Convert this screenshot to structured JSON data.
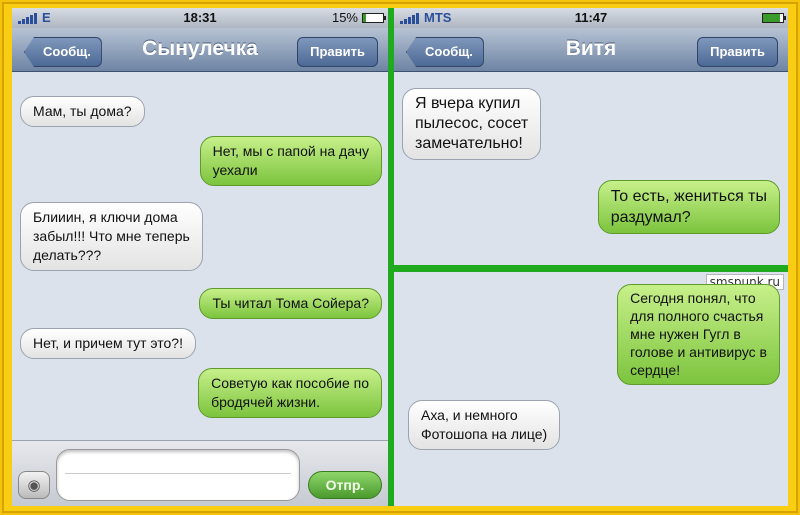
{
  "chat1": {
    "status": {
      "carrier": "E",
      "time": "18:31",
      "battery_text": "15%"
    },
    "nav": {
      "back_label": "Сообщ.",
      "title": "Сынулечка",
      "edit_label": "Править"
    },
    "messages": [
      {
        "dir": "in",
        "lines": [
          "Мам, ты дома?"
        ]
      },
      {
        "dir": "out",
        "lines": [
          "Нет, мы с папой на дачу",
          "уехали"
        ]
      },
      {
        "dir": "in",
        "lines": [
          "Блииин, я ключи дома",
          "забыл!!! Что мне теперь",
          "делать???"
        ]
      },
      {
        "dir": "out",
        "lines": [
          "Ты читал Тома Сойера?"
        ]
      },
      {
        "dir": "in",
        "lines": [
          "Нет, и причем тут это?!"
        ]
      },
      {
        "dir": "out",
        "lines": [
          "Советую как пособие по",
          "бродячей жизни."
        ]
      }
    ],
    "composer": {
      "send_label": "Отпр."
    }
  },
  "chat2": {
    "status": {
      "carrier": "MTS",
      "time": "11:47"
    },
    "nav": {
      "back_label": "Сообщ.",
      "title": "Витя",
      "edit_label": "Править"
    },
    "messages": [
      {
        "dir": "in",
        "lines": [
          "Я вчера купил",
          "пылесос, сосет",
          "замечательно!"
        ]
      },
      {
        "dir": "out",
        "lines": [
          "То есть, жениться ты",
          "раздумал?"
        ]
      }
    ]
  },
  "chat3": {
    "watermark": "smspunk.ru",
    "messages": [
      {
        "dir": "out",
        "lines": [
          "Сегодня понял, что",
          "для полного счастья",
          "мне нужен Гугл в",
          "голове и антивирус в",
          "сердце!"
        ]
      },
      {
        "dir": "in",
        "lines": [
          "Аха, и немного",
          "Фотошопа на лице)"
        ]
      }
    ]
  }
}
